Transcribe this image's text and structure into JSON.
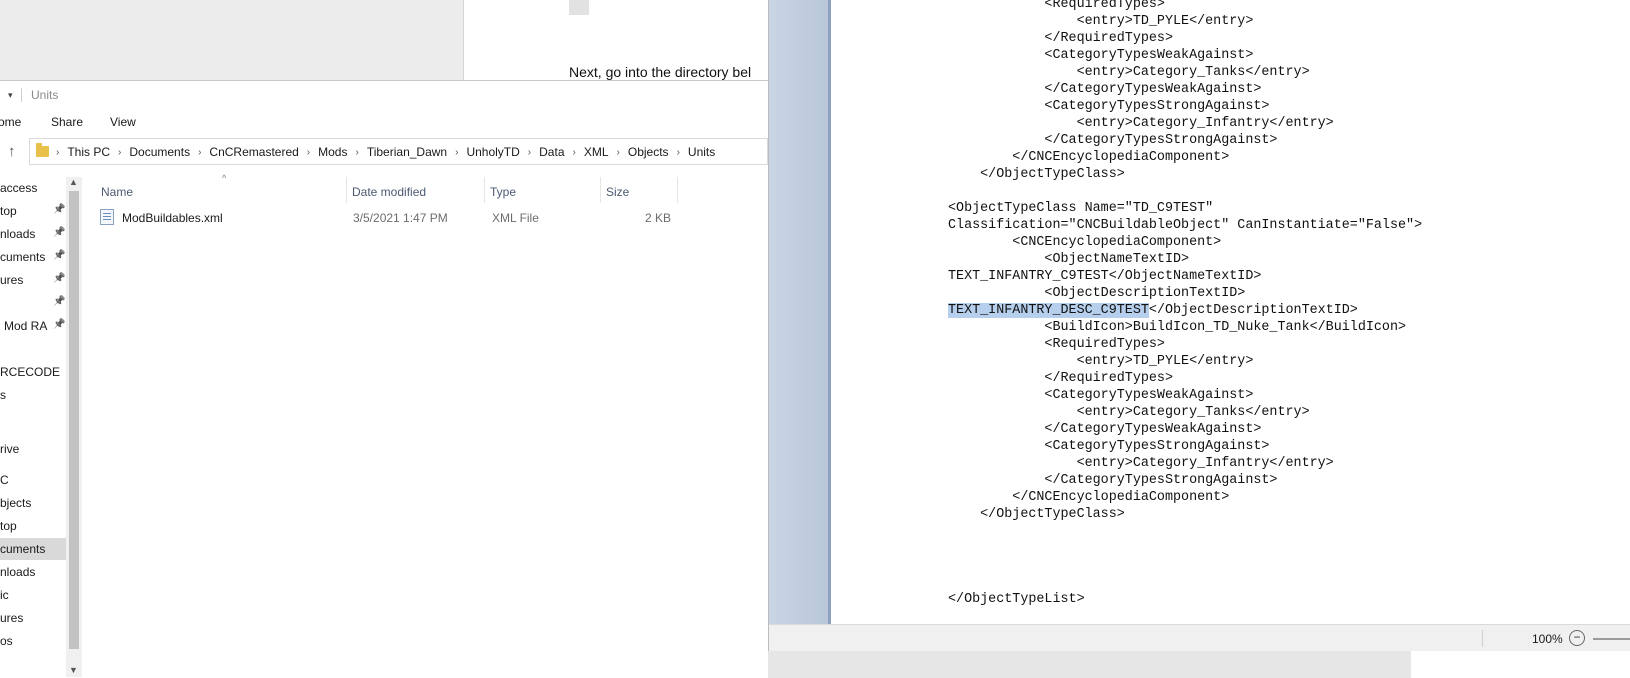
{
  "background_doc": {
    "text": "Next, go into the directory bel"
  },
  "explorer": {
    "title": "Units",
    "ribbon_tabs": [
      "ome",
      "Share",
      "View"
    ],
    "breadcrumb": [
      "This PC",
      "Documents",
      "CnCRemastered",
      "Mods",
      "Tiberian_Dawn",
      "UnholyTD",
      "Data",
      "XML",
      "Objects",
      "Units"
    ],
    "nav_items": [
      {
        "label": "access",
        "pinned": false
      },
      {
        "label": "top",
        "pinned": true
      },
      {
        "label": "nloads",
        "pinned": true
      },
      {
        "label": "cuments",
        "pinned": true
      },
      {
        "label": "ures",
        "pinned": true
      },
      {
        "label": "",
        "pinned": true
      },
      {
        "label": "Mod RA",
        "pinned": true
      },
      {
        "label": "RCECODE",
        "pinned": false
      },
      {
        "label": "s",
        "pinned": false
      },
      {
        "label": "rive",
        "pinned": false
      },
      {
        "label": "C",
        "pinned": false
      },
      {
        "label": "bjects",
        "pinned": false
      },
      {
        "label": "top",
        "pinned": false
      },
      {
        "label": "cuments",
        "pinned": false,
        "selected": true
      },
      {
        "label": "nloads",
        "pinned": false
      },
      {
        "label": "ic",
        "pinned": false
      },
      {
        "label": "ures",
        "pinned": false
      },
      {
        "label": "os",
        "pinned": false
      }
    ],
    "columns": {
      "name": "Name",
      "date": "Date modified",
      "type": "Type",
      "size": "Size"
    },
    "files": [
      {
        "name": "ModBuildables.xml",
        "date": "3/5/2021 1:47 PM",
        "type": "XML File",
        "size": "2 KB"
      }
    ]
  },
  "editor": {
    "lines_before_highlight": [
      "            <RequiredTypes>",
      "                <entry>TD_PYLE</entry>",
      "            </RequiredTypes>",
      "            <CategoryTypesWeakAgainst>",
      "                <entry>Category_Tanks</entry>",
      "            </CategoryTypesWeakAgainst>",
      "            <CategoryTypesStrongAgainst>",
      "                <entry>Category_Infantry</entry>",
      "            </CategoryTypesStrongAgainst>",
      "        </CNCEncyclopediaComponent>",
      "    </ObjectTypeClass>",
      "",
      "<ObjectTypeClass Name=\"TD_C9TEST\"",
      "Classification=\"CNCBuildableObject\" CanInstantiate=\"False\">",
      "        <CNCEncyclopediaComponent>",
      "            <ObjectNameTextID>",
      "TEXT_INFANTRY_C9TEST</ObjectNameTextID>",
      "            <ObjectDescriptionTextID>"
    ],
    "highlight_text": "TEXT_INFANTRY_DESC_C9TEST",
    "highlight_rest": "</ObjectDescriptionTextID>",
    "lines_after_highlight": [
      "            <BuildIcon>BuildIcon_TD_Nuke_Tank</BuildIcon>",
      "            <RequiredTypes>",
      "                <entry>TD_PYLE</entry>",
      "            </RequiredTypes>",
      "            <CategoryTypesWeakAgainst>",
      "                <entry>Category_Tanks</entry>",
      "            </CategoryTypesWeakAgainst>",
      "            <CategoryTypesStrongAgainst>",
      "                <entry>Category_Infantry</entry>",
      "            </CategoryTypesStrongAgainst>",
      "        </CNCEncyclopediaComponent>",
      "    </ObjectTypeClass>",
      "",
      "",
      "",
      "",
      "</ObjectTypeList>"
    ],
    "zoom": "100%"
  },
  "colors": {
    "selection": "#b5cfec",
    "editor_margin": "#c9d5e5",
    "nav_selected": "#d9d9d9"
  }
}
